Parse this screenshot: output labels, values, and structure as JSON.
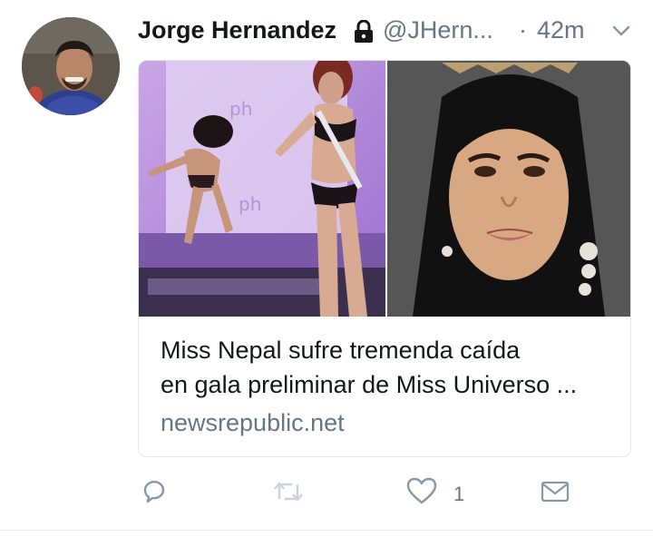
{
  "tweet": {
    "author_name": "Jorge Hernandez",
    "handle": "@JHern...",
    "separator": "·",
    "time": "42m"
  },
  "card": {
    "title_line1": "Miss Nepal sufre tremenda caída",
    "title_line2": "en gala preliminar de Miss Universo ...",
    "domain": "newsrepublic.net"
  },
  "actions": {
    "like_count": "1"
  },
  "colors": {
    "text": "#14171a",
    "secondary": "#657786",
    "border": "#e1e8ed"
  },
  "icons": [
    "lock-icon",
    "chevron-down-icon",
    "reply-icon",
    "retweet-icon",
    "heart-icon",
    "direct-message-icon"
  ]
}
